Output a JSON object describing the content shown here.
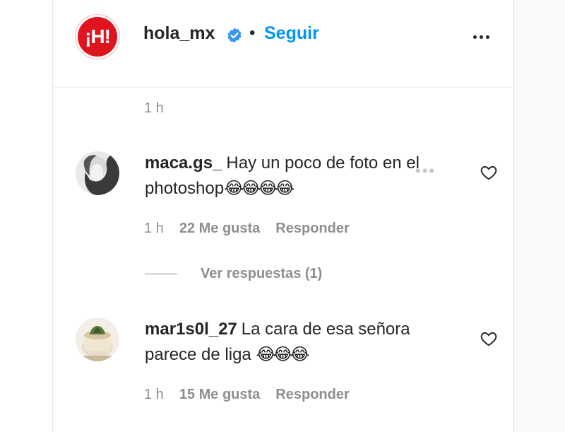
{
  "header": {
    "logo_text": "¡H!",
    "username": "hola_mx",
    "separator": "•",
    "follow_label": "Seguir",
    "verified_color": "#3897f0",
    "brand_color": "#e0141e"
  },
  "post": {
    "time": "1 h"
  },
  "comments": [
    {
      "username": "maca.gs_",
      "text": "Hay un poco de foto en el photoshop",
      "emoji": "😂😂😂😂",
      "time": "1 h",
      "likes": "22 Me gusta",
      "reply_label": "Responder",
      "view_replies": "Ver respuestas (1)"
    },
    {
      "username": "mar1s0l_27",
      "text": "La cara de esa señora parece de liga",
      "emoji": "😂😂😂",
      "time": "1 h",
      "likes": "15 Me gusta",
      "reply_label": "Responder"
    }
  ],
  "colors": {
    "link": "#0095f6",
    "muted": "#8e8e8e",
    "text": "#262626"
  },
  "icons": {
    "verified": "verified-badge-icon",
    "more": "more-options-icon",
    "heart": "heart-outline-icon"
  }
}
